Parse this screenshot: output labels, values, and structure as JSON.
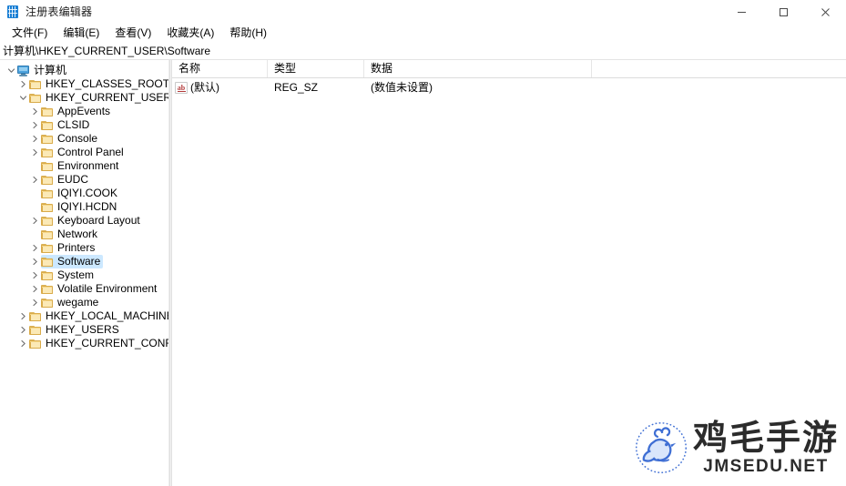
{
  "window": {
    "title": "注册表编辑器",
    "icon": "registry-editor-icon",
    "controls": {
      "minimize": "最小化",
      "maximize": "最大化",
      "close": "关闭"
    }
  },
  "menu": {
    "items": [
      {
        "label": "文件(F)",
        "text": "文件",
        "accel": "F"
      },
      {
        "label": "编辑(E)",
        "text": "编辑",
        "accel": "E"
      },
      {
        "label": "查看(V)",
        "text": "查看",
        "accel": "V"
      },
      {
        "label": "收藏夹(A)",
        "text": "收藏夹",
        "accel": "A"
      },
      {
        "label": "帮助(H)",
        "text": "帮助",
        "accel": "H"
      }
    ]
  },
  "address": {
    "path": "计算机\\HKEY_CURRENT_USER\\Software"
  },
  "tree": {
    "nodes": [
      {
        "label": "计算机",
        "depth": 0,
        "icon": "computer-icon",
        "expander": "expanded",
        "selected": false
      },
      {
        "label": "HKEY_CLASSES_ROOT",
        "depth": 1,
        "icon": "folder-icon",
        "expander": "collapsed",
        "selected": false
      },
      {
        "label": "HKEY_CURRENT_USER",
        "depth": 1,
        "icon": "folder-icon",
        "expander": "expanded",
        "selected": false
      },
      {
        "label": "AppEvents",
        "depth": 2,
        "icon": "folder-icon",
        "expander": "collapsed",
        "selected": false
      },
      {
        "label": "CLSID",
        "depth": 2,
        "icon": "folder-icon",
        "expander": "collapsed",
        "selected": false
      },
      {
        "label": "Console",
        "depth": 2,
        "icon": "folder-icon",
        "expander": "collapsed",
        "selected": false
      },
      {
        "label": "Control Panel",
        "depth": 2,
        "icon": "folder-icon",
        "expander": "collapsed",
        "selected": false
      },
      {
        "label": "Environment",
        "depth": 2,
        "icon": "folder-icon",
        "expander": "none",
        "selected": false
      },
      {
        "label": "EUDC",
        "depth": 2,
        "icon": "folder-icon",
        "expander": "collapsed",
        "selected": false
      },
      {
        "label": "IQIYI.COOK",
        "depth": 2,
        "icon": "folder-icon",
        "expander": "none",
        "selected": false
      },
      {
        "label": "IQIYI.HCDN",
        "depth": 2,
        "icon": "folder-icon",
        "expander": "none",
        "selected": false
      },
      {
        "label": "Keyboard Layout",
        "depth": 2,
        "icon": "folder-icon",
        "expander": "collapsed",
        "selected": false
      },
      {
        "label": "Network",
        "depth": 2,
        "icon": "folder-icon",
        "expander": "none",
        "selected": false
      },
      {
        "label": "Printers",
        "depth": 2,
        "icon": "folder-icon",
        "expander": "collapsed",
        "selected": false
      },
      {
        "label": "Software",
        "depth": 2,
        "icon": "folder-icon",
        "expander": "collapsed",
        "selected": true
      },
      {
        "label": "System",
        "depth": 2,
        "icon": "folder-icon",
        "expander": "collapsed",
        "selected": false
      },
      {
        "label": "Volatile Environment",
        "depth": 2,
        "icon": "folder-icon",
        "expander": "collapsed",
        "selected": false
      },
      {
        "label": "wegame",
        "depth": 2,
        "icon": "folder-icon",
        "expander": "collapsed",
        "selected": false
      },
      {
        "label": "HKEY_LOCAL_MACHINE",
        "depth": 1,
        "icon": "folder-icon",
        "expander": "collapsed",
        "selected": false
      },
      {
        "label": "HKEY_USERS",
        "depth": 1,
        "icon": "folder-icon",
        "expander": "collapsed",
        "selected": false
      },
      {
        "label": "HKEY_CURRENT_CONFIG",
        "depth": 1,
        "icon": "folder-icon",
        "expander": "collapsed",
        "selected": false
      }
    ]
  },
  "list": {
    "columns": [
      {
        "label": "名称",
        "key": "name"
      },
      {
        "label": "类型",
        "key": "type"
      },
      {
        "label": "数据",
        "key": "data"
      }
    ],
    "rows": [
      {
        "name": "(默认)",
        "type": "REG_SZ",
        "data": "(数值未设置)",
        "icon": "string-value-icon"
      }
    ]
  },
  "watermark": {
    "cn": "鸡毛手游",
    "en": "JMSEDU.NET",
    "logo": "chicken-logo",
    "logo_color": "#3f6fd4"
  },
  "colors": {
    "selection": "#cce8ff",
    "folder": "#f6d98c",
    "accent": "#1a7fd4"
  }
}
